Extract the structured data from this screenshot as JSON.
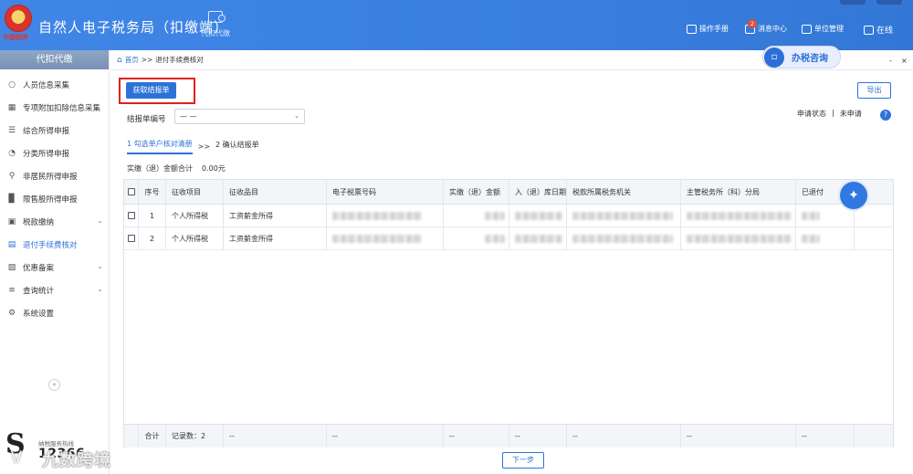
{
  "header": {
    "logo_text": "中国税务",
    "app_title": "自然人电子税务局（扣缴端）",
    "module_tab": "代扣代缴",
    "right_items": [
      {
        "label": "操作手册",
        "icon": "book-icon"
      },
      {
        "label": "消息中心",
        "icon": "mail-icon"
      },
      {
        "label": "单位管理",
        "icon": "building-icon"
      },
      {
        "label": "在线",
        "icon": "chat-icon"
      }
    ],
    "message_badge": "2"
  },
  "sidebar": {
    "title": "代扣代缴",
    "items": [
      {
        "label": "人员信息采集",
        "icon": "person-icon"
      },
      {
        "label": "专项附加扣除信息采集",
        "icon": "grid-icon"
      },
      {
        "label": "综合所得申报",
        "icon": "layers-icon"
      },
      {
        "label": "分类所得申报",
        "icon": "pie-icon"
      },
      {
        "label": "非居民所得申报",
        "icon": "person-search-icon"
      },
      {
        "label": "限售股所得申报",
        "icon": "bar-chart-icon"
      },
      {
        "label": "税款缴纳",
        "icon": "wallet-icon",
        "has_children": true
      },
      {
        "label": "退付手续费核对",
        "icon": "document-icon",
        "active": true
      },
      {
        "label": "优惠备案",
        "icon": "folder-icon",
        "has_children": true
      },
      {
        "label": "查询统计",
        "icon": "search-list-icon",
        "has_children": true
      },
      {
        "label": "系统设置",
        "icon": "gear-icon"
      }
    ],
    "hotline_label": "纳税服务热线",
    "hotline_number": "12366",
    "watermark": "九数跨境"
  },
  "breadcrumb": {
    "home": "首页",
    "separator": ">>",
    "current": "退付手续费核对"
  },
  "consult_button": "办税咨询",
  "page_controls": {
    "minimize": "-",
    "close": "×"
  },
  "main": {
    "fetch_button": "获取结报单",
    "export_button": "导出",
    "report_no_label": "结报单编号",
    "report_no_value": "— —",
    "status_label": "申请状态",
    "status_divider": "|",
    "status_value": "未申请",
    "help_icon": "?",
    "steps": {
      "step1": "1 勾选单户核对清册",
      "separator": ">>",
      "step2": "2 确认结报单"
    },
    "amount_label": "实缴（退）金额合计",
    "amount_value": "0.00元",
    "next_button": "下一步"
  },
  "table": {
    "columns": [
      "序号",
      "征收项目",
      "征收品目",
      "电子税票号码",
      "实缴（退）金额",
      "入（退）库日期",
      "税款所属税务机关",
      "主管税务所（科）分局",
      "已退付"
    ],
    "rows": [
      {
        "index": "1",
        "item": "个人所得税",
        "subitem": "工资薪金所得"
      },
      {
        "index": "2",
        "item": "个人所得税",
        "subitem": "工资薪金所得"
      }
    ],
    "footer": {
      "total_label": "合计",
      "record_count": "记录数：2",
      "placeholder": "--"
    }
  },
  "colors": {
    "header_blue": "#3f86e6",
    "accent": "#2d72d9",
    "highlight_red": "#e02020"
  }
}
